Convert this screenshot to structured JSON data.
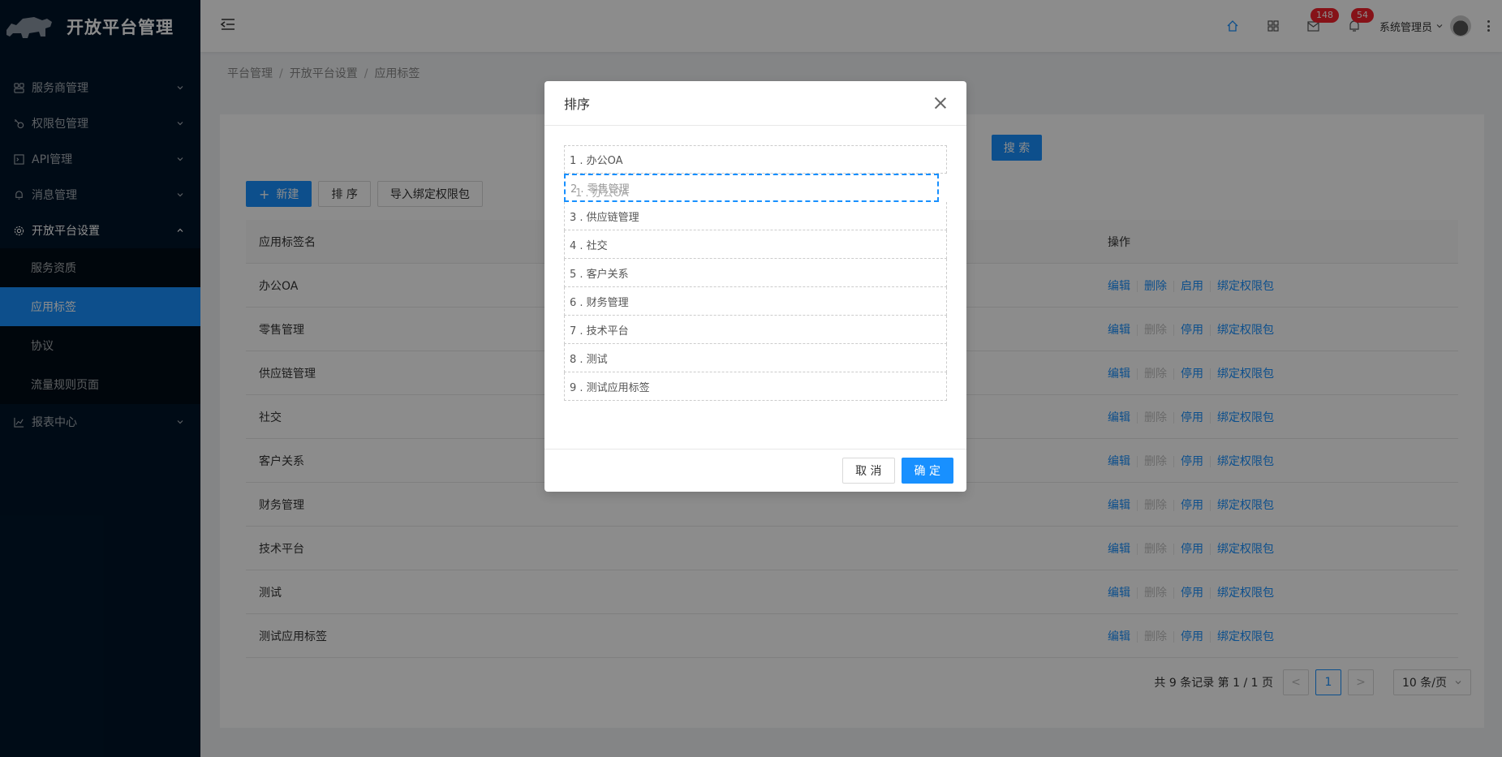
{
  "app": {
    "title": "开放平台管理"
  },
  "sidebar": {
    "menu": [
      {
        "label": "服务商管理",
        "icon": "users-icon"
      },
      {
        "label": "权限包管理",
        "icon": "key-icon"
      },
      {
        "label": "API管理",
        "icon": "api-icon"
      },
      {
        "label": "消息管理",
        "icon": "bell-icon"
      },
      {
        "label": "开放平台设置",
        "icon": "gear-icon"
      },
      {
        "label": "报表中心",
        "icon": "chart-icon"
      }
    ],
    "submenu": [
      {
        "label": "服务资质"
      },
      {
        "label": "应用标签"
      },
      {
        "label": "协议"
      },
      {
        "label": "流量规则页面"
      }
    ]
  },
  "header": {
    "mail_badge": "148",
    "bell_badge": "54",
    "user_name": "系统管理员"
  },
  "breadcrumb": [
    "平台管理",
    "开放平台设置",
    "应用标签"
  ],
  "toolbar": {
    "search_label": "搜 索",
    "new_label": "新建",
    "sort_label": "排 序",
    "import_label": "导入绑定权限包"
  },
  "table": {
    "headers": {
      "name": "应用标签名",
      "ops": "操作"
    },
    "rows": [
      {
        "name": "办公OA",
        "ops": [
          "编辑",
          "删除",
          "启用",
          "绑定权限包"
        ]
      },
      {
        "name": "零售管理",
        "ops": [
          "编辑",
          "删除",
          "停用",
          "绑定权限包"
        ]
      },
      {
        "name": "供应链管理",
        "ops": [
          "编辑",
          "删除",
          "停用",
          "绑定权限包"
        ]
      },
      {
        "name": "社交",
        "ops": [
          "编辑",
          "删除",
          "停用",
          "绑定权限包"
        ]
      },
      {
        "name": "客户关系",
        "ops": [
          "编辑",
          "删除",
          "停用",
          "绑定权限包"
        ]
      },
      {
        "name": "财务管理",
        "ops": [
          "编辑",
          "删除",
          "停用",
          "绑定权限包"
        ]
      },
      {
        "name": "技术平台",
        "ops": [
          "编辑",
          "删除",
          "停用",
          "绑定权限包"
        ]
      },
      {
        "name": "测试",
        "ops": [
          "编辑",
          "删除",
          "停用",
          "绑定权限包"
        ]
      },
      {
        "name": "测试应用标签",
        "ops": [
          "编辑",
          "删除",
          "停用",
          "绑定权限包"
        ]
      }
    ]
  },
  "pagination": {
    "total_text": "共 9 条记录 第 1 / 1 页",
    "prev": "<",
    "current": "1",
    "next": ">",
    "page_size": "10 条/页"
  },
  "modal": {
    "title": "排序",
    "items": [
      "1 . 办公OA",
      "2 . 零售管理",
      "3 . 供应链管理",
      "4 . 社交",
      "5 . 客户关系",
      "6 . 财务管理",
      "7 . 技术平台",
      "8 . 测试",
      "9 . 测试应用标签"
    ],
    "ghost_label": "1 . 办公OA",
    "cancel_label": "取 消",
    "ok_label": "确 定"
  },
  "colors": {
    "primary": "#1890ff",
    "sidebar_bg": "#001529",
    "badge": "#f5222d"
  }
}
